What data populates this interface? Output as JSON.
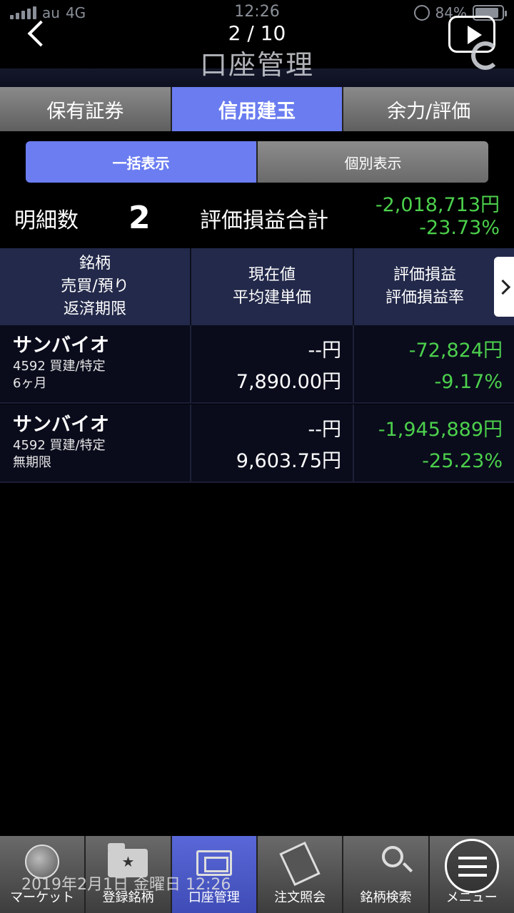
{
  "status_bar": {
    "carrier": "au",
    "network": "4G",
    "time": "12:26",
    "battery": "84%"
  },
  "header": {
    "page_count": "2 / 10",
    "title": "口座管理"
  },
  "tabs": [
    {
      "label": "保有証券",
      "active": false
    },
    {
      "label": "信用建玉",
      "active": true
    },
    {
      "label": "余力/評価",
      "active": false
    }
  ],
  "segment": {
    "bulk": "一括表示",
    "individual": "個別表示"
  },
  "summary": {
    "count_label": "明細数",
    "count": "2",
    "total_label": "評価損益合計",
    "total_amount": "-2,018,713円",
    "total_rate": "-23.73%"
  },
  "table": {
    "headers": {
      "col1": [
        "銘柄",
        "売買/預り",
        "返済期限"
      ],
      "col2": [
        "現在値",
        "平均建単価"
      ],
      "col3": [
        "評価損益",
        "評価損益率"
      ]
    },
    "rows": [
      {
        "name": "サンバイオ",
        "code_type": "4592 買建/特定",
        "term": "6ヶ月",
        "current_price": "--円",
        "avg_price": "7,890.00円",
        "pl": "-72,824円",
        "pl_rate": "-9.17%"
      },
      {
        "name": "サンバイオ",
        "code_type": "4592 買建/特定",
        "term": "無期限",
        "current_price": "--円",
        "avg_price": "9,603.75円",
        "pl": "-1,945,889円",
        "pl_rate": "-25.23%"
      }
    ]
  },
  "bottom_nav": [
    {
      "label": "マーケット",
      "icon": "globe-icon"
    },
    {
      "label": "登録銘柄",
      "icon": "folder-star-icon"
    },
    {
      "label": "口座管理",
      "icon": "account-icon",
      "active": true
    },
    {
      "label": "注文照会",
      "icon": "book-icon"
    },
    {
      "label": "銘柄検索",
      "icon": "search-icon"
    },
    {
      "label": "メニュー",
      "icon": "menu-icon"
    }
  ],
  "datetime_overlay": "2019年2月1日 金曜日 12:26",
  "colors": {
    "accent": "#6a7cf0",
    "positive_green": "#4cd04c",
    "table_header_bg": "#23294a"
  }
}
